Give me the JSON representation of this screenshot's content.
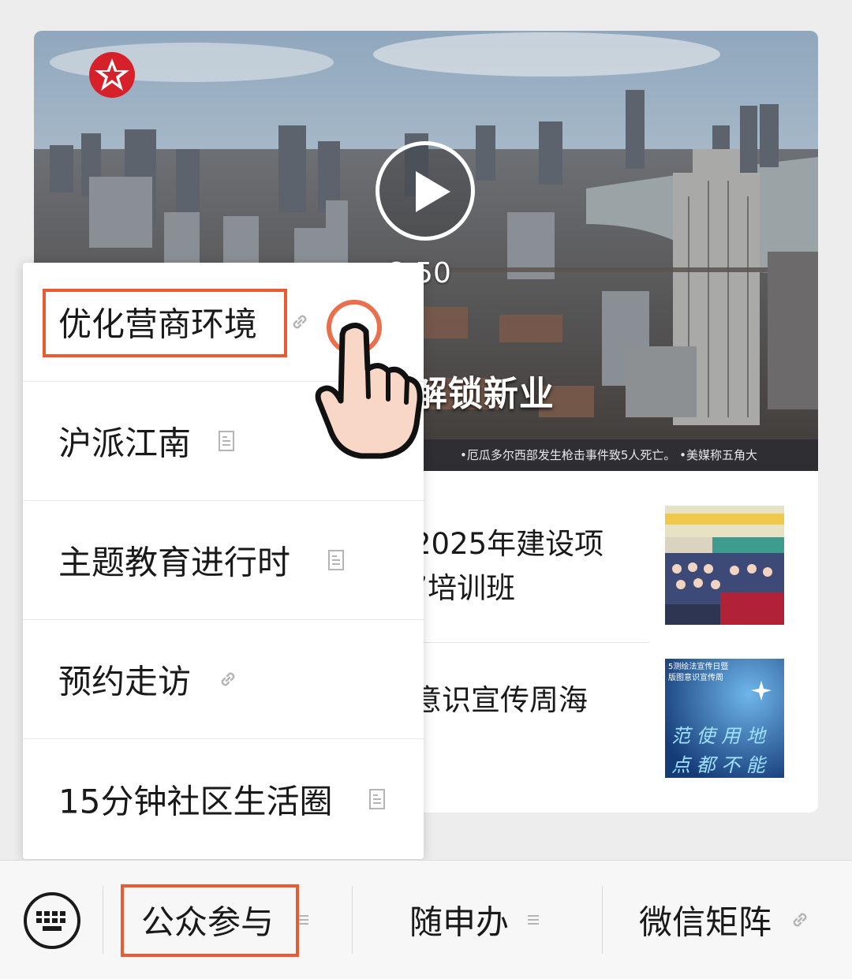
{
  "video": {
    "duration": "8:50",
    "caption": "商务楼宇如何“解锁新业",
    "ticker": "•厄瓜多尔西部发生枪击事件致5人死亡。    •美媒称五角大"
  },
  "articles": [
    {
      "title": "2025年建设项 ”培训班"
    },
    {
      "title": "意识宣传周海"
    }
  ],
  "thumb_text": {
    "header_line1": "5测绘法宣传日暨",
    "header_line2": "版图意识宣传周",
    "chars_row1": "范 使 用 地",
    "chars_row2": "点 都 不 能"
  },
  "menu": {
    "items": [
      {
        "label": "优化营商环境",
        "icon": "link-icon"
      },
      {
        "label": "沪派江南",
        "icon": "article-icon"
      },
      {
        "label": "主题教育进行时",
        "icon": "article-icon"
      },
      {
        "label": "预约走访",
        "icon": "link-icon"
      },
      {
        "label": "15分钟社区生活圈",
        "icon": "article-icon"
      }
    ]
  },
  "bottom_bar": {
    "items": [
      {
        "label": "公众参与",
        "icon": "menu-lines-icon"
      },
      {
        "label": "随申办",
        "icon": "menu-lines-icon"
      },
      {
        "label": "微信矩阵",
        "icon": "link-icon"
      }
    ]
  },
  "colors": {
    "highlight": "#ea5a33",
    "background": "#ededed"
  }
}
